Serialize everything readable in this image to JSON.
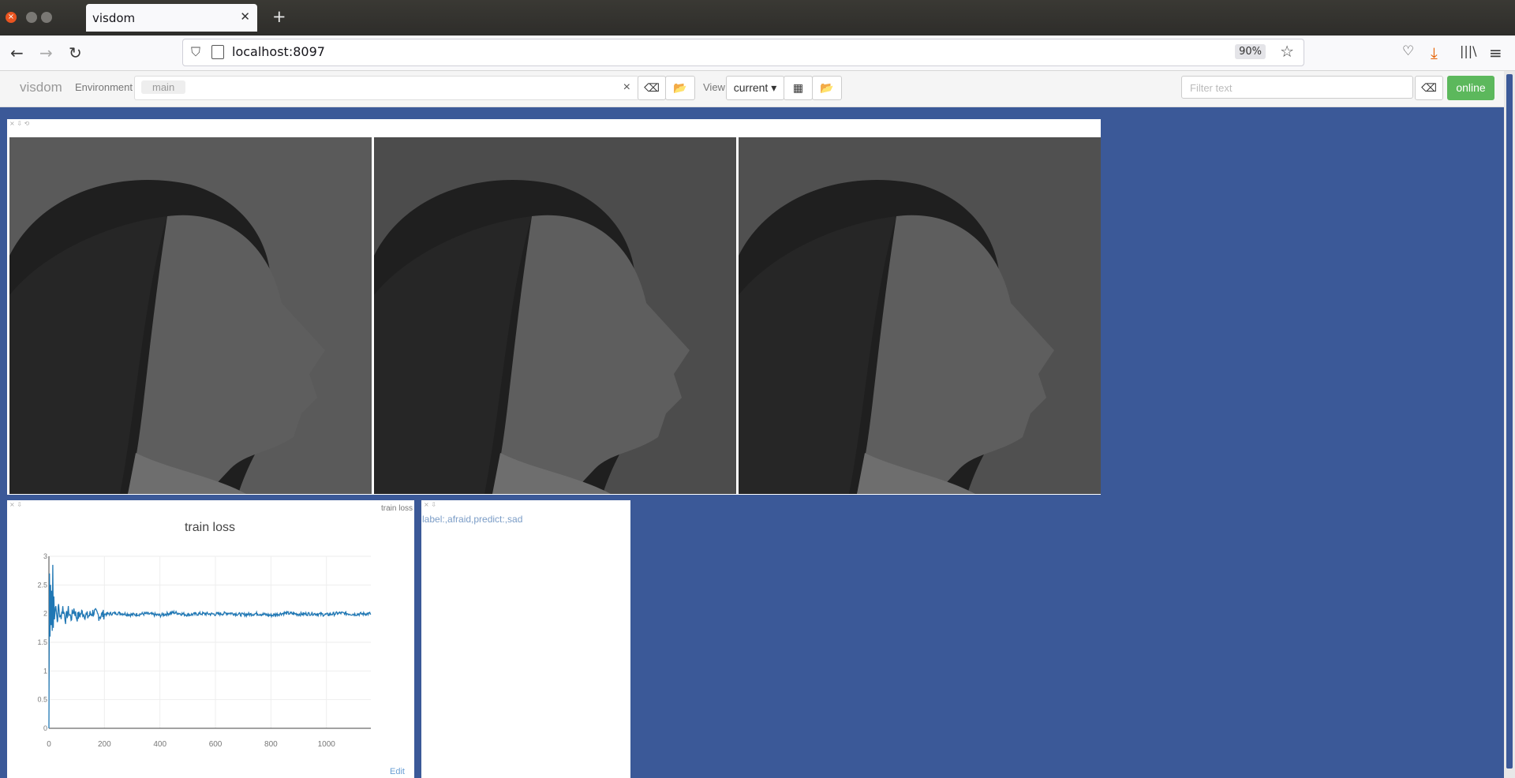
{
  "browser": {
    "tab_title": "visdom",
    "url": "localhost:8097",
    "zoom": "90%"
  },
  "toolbar": {
    "brand": "visdom",
    "environment_label": "Environment",
    "environment_chip": "main",
    "view_label": "View",
    "view_select": "current",
    "filter_placeholder": "Filter text",
    "online_label": "online"
  },
  "text_pane": {
    "content": "label:,afraid,predict:,sad"
  },
  "loss_pane": {
    "title_tag": "train loss",
    "edit_label": "Edit"
  },
  "chart_data": {
    "type": "line",
    "title": "train loss",
    "xlabel": "",
    "ylabel": "",
    "xlim": [
      0,
      1160
    ],
    "ylim": [
      0,
      3
    ],
    "x_ticks": [
      "0",
      "200",
      "400",
      "600",
      "800",
      "1000"
    ],
    "y_ticks": [
      "0",
      "0.5",
      "1",
      "1.5",
      "2",
      "2.5",
      "3"
    ],
    "grid": true,
    "series": [
      {
        "color": "#1f77b4",
        "x": [
          0,
          2,
          4,
          6,
          8,
          10,
          12,
          14,
          16,
          18,
          20,
          25,
          30,
          35,
          40,
          50,
          60,
          70,
          80,
          90,
          100,
          120,
          140,
          160,
          180,
          200,
          250,
          300,
          350,
          400,
          450,
          500,
          550,
          600,
          650,
          700,
          750,
          800,
          850,
          900,
          950,
          1000,
          1050,
          1100,
          1160
        ],
        "y": [
          0.0,
          2.7,
          1.6,
          2.5,
          1.8,
          2.4,
          1.7,
          2.85,
          1.75,
          2.3,
          1.9,
          2.2,
          1.85,
          2.15,
          1.9,
          2.1,
          1.9,
          2.05,
          1.92,
          2.08,
          1.93,
          2.02,
          1.95,
          2.03,
          1.96,
          1.99,
          2.01,
          1.98,
          2.0,
          1.97,
          2.02,
          1.98,
          2.0,
          1.99,
          2.01,
          1.98,
          2.0,
          1.97,
          2.01,
          1.99,
          2.0,
          1.98,
          2.01,
          1.99,
          2.0
        ]
      }
    ]
  }
}
